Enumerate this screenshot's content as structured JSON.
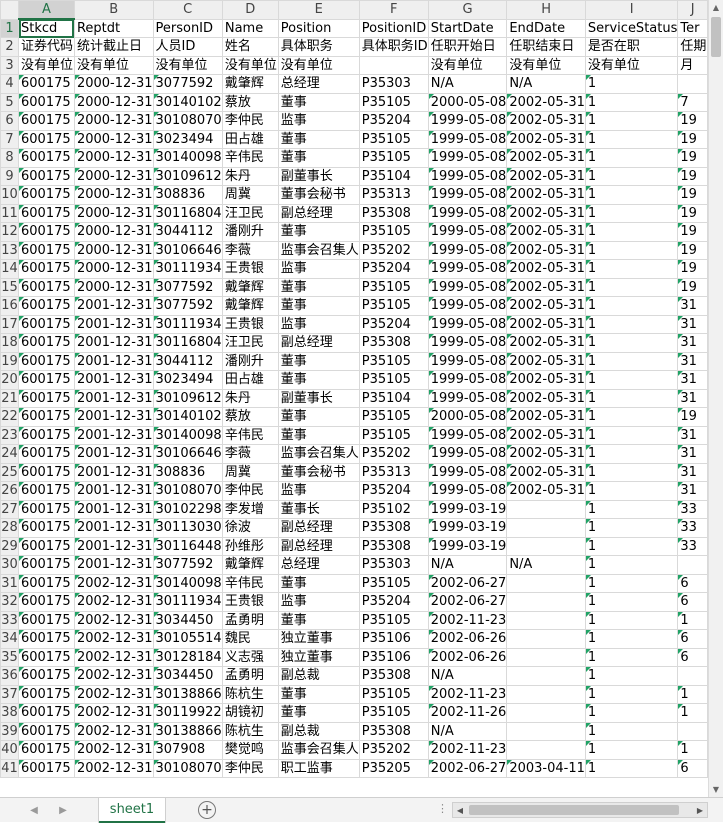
{
  "columns": [
    "A",
    "B",
    "C",
    "D",
    "E",
    "F",
    "G",
    "H",
    "I",
    "J"
  ],
  "active_cell": "A1",
  "sheet_tab": "sheet1",
  "row_numbers": [
    "1",
    "2",
    "3",
    "4",
    "5",
    "6",
    "7",
    "8",
    "9",
    "10",
    "11",
    "12",
    "13",
    "14",
    "15",
    "16",
    "17",
    "18",
    "19",
    "20",
    "21",
    "22",
    "23",
    "24",
    "25",
    "26",
    "27",
    "28",
    "29",
    "30",
    "31",
    "32",
    "33",
    "34",
    "35",
    "36",
    "37",
    "38",
    "39",
    "40",
    "41"
  ],
  "rows": [
    [
      "Stkcd",
      "Reptdt",
      "PersonID",
      "Name",
      "Position",
      "PositionID",
      "StartDate",
      "EndDate",
      "ServiceStatus",
      "Ter"
    ],
    [
      "证券代码",
      "统计截止日",
      "人员ID",
      "姓名",
      "具体职务",
      "具体职务ID",
      "任职开始日",
      "任职结束日",
      "是否在职",
      "任期"
    ],
    [
      "没有单位",
      "没有单位",
      "没有单位",
      "没有单位",
      "没有单位",
      "",
      "没有单位",
      "没有单位",
      "没有单位",
      "月"
    ],
    [
      "600175",
      "2000-12-31",
      "3077592",
      "戴肇辉",
      "总经理",
      "P35303",
      "N/A",
      "N/A",
      "1",
      ""
    ],
    [
      "600175",
      "2000-12-31",
      "30140102",
      "蔡放",
      "董事",
      "P35105",
      "2000-05-08",
      "2002-05-31",
      "1",
      "7"
    ],
    [
      "600175",
      "2000-12-31",
      "30108070",
      "李仲民",
      "监事",
      "P35204",
      "1999-05-08",
      "2002-05-31",
      "1",
      "19"
    ],
    [
      "600175",
      "2000-12-31",
      "3023494",
      "田占雄",
      "董事",
      "P35105",
      "1999-05-08",
      "2002-05-31",
      "1",
      "19"
    ],
    [
      "600175",
      "2000-12-31",
      "30140098",
      "辛伟民",
      "董事",
      "P35105",
      "1999-05-08",
      "2002-05-31",
      "1",
      "19"
    ],
    [
      "600175",
      "2000-12-31",
      "30109612",
      "朱丹",
      "副董事长",
      "P35104",
      "1999-05-08",
      "2002-05-31",
      "1",
      "19"
    ],
    [
      "600175",
      "2000-12-31",
      "308836",
      "周冀",
      "董事会秘书",
      "P35313",
      "1999-05-08",
      "2002-05-31",
      "1",
      "19"
    ],
    [
      "600175",
      "2000-12-31",
      "30116804",
      "汪卫民",
      "副总经理",
      "P35308",
      "1999-05-08",
      "2002-05-31",
      "1",
      "19"
    ],
    [
      "600175",
      "2000-12-31",
      "3044112",
      "潘刚升",
      "董事",
      "P35105",
      "1999-05-08",
      "2002-05-31",
      "1",
      "19"
    ],
    [
      "600175",
      "2000-12-31",
      "30106646",
      "李薇",
      "监事会召集人",
      "P35202",
      "1999-05-08",
      "2002-05-31",
      "1",
      "19"
    ],
    [
      "600175",
      "2000-12-31",
      "30111934",
      "王贵银",
      "监事",
      "P35204",
      "1999-05-08",
      "2002-05-31",
      "1",
      "19"
    ],
    [
      "600175",
      "2000-12-31",
      "3077592",
      "戴肇辉",
      "董事",
      "P35105",
      "1999-05-08",
      "2002-05-31",
      "1",
      "19"
    ],
    [
      "600175",
      "2001-12-31",
      "3077592",
      "戴肇辉",
      "董事",
      "P35105",
      "1999-05-08",
      "2002-05-31",
      "1",
      "31"
    ],
    [
      "600175",
      "2001-12-31",
      "30111934",
      "王贵银",
      "监事",
      "P35204",
      "1999-05-08",
      "2002-05-31",
      "1",
      "31"
    ],
    [
      "600175",
      "2001-12-31",
      "30116804",
      "汪卫民",
      "副总经理",
      "P35308",
      "1999-05-08",
      "2002-05-31",
      "1",
      "31"
    ],
    [
      "600175",
      "2001-12-31",
      "3044112",
      "潘刚升",
      "董事",
      "P35105",
      "1999-05-08",
      "2002-05-31",
      "1",
      "31"
    ],
    [
      "600175",
      "2001-12-31",
      "3023494",
      "田占雄",
      "董事",
      "P35105",
      "1999-05-08",
      "2002-05-31",
      "1",
      "31"
    ],
    [
      "600175",
      "2001-12-31",
      "30109612",
      "朱丹",
      "副董事长",
      "P35104",
      "1999-05-08",
      "2002-05-31",
      "1",
      "31"
    ],
    [
      "600175",
      "2001-12-31",
      "30140102",
      "蔡放",
      "董事",
      "P35105",
      "2000-05-08",
      "2002-05-31",
      "1",
      "19"
    ],
    [
      "600175",
      "2001-12-31",
      "30140098",
      "辛伟民",
      "董事",
      "P35105",
      "1999-05-08",
      "2002-05-31",
      "1",
      "31"
    ],
    [
      "600175",
      "2001-12-31",
      "30106646",
      "李薇",
      "监事会召集人",
      "P35202",
      "1999-05-08",
      "2002-05-31",
      "1",
      "31"
    ],
    [
      "600175",
      "2001-12-31",
      "308836",
      "周冀",
      "董事会秘书",
      "P35313",
      "1999-05-08",
      "2002-05-31",
      "1",
      "31"
    ],
    [
      "600175",
      "2001-12-31",
      "30108070",
      "李仲民",
      "监事",
      "P35204",
      "1999-05-08",
      "2002-05-31",
      "1",
      "31"
    ],
    [
      "600175",
      "2001-12-31",
      "30102298",
      "李发增",
      "董事长",
      "P35102",
      "1999-03-19",
      "",
      "1",
      "33"
    ],
    [
      "600175",
      "2001-12-31",
      "30113030",
      "徐波",
      "副总经理",
      "P35308",
      "1999-03-19",
      "",
      "1",
      "33"
    ],
    [
      "600175",
      "2001-12-31",
      "30116448",
      "孙维彤",
      "副总经理",
      "P35308",
      "1999-03-19",
      "",
      "1",
      "33"
    ],
    [
      "600175",
      "2001-12-31",
      "3077592",
      "戴肇辉",
      "总经理",
      "P35303",
      "N/A",
      "N/A",
      "1",
      ""
    ],
    [
      "600175",
      "2002-12-31",
      "30140098",
      "辛伟民",
      "董事",
      "P35105",
      "2002-06-27",
      "",
      "1",
      "6"
    ],
    [
      "600175",
      "2002-12-31",
      "30111934",
      "王贵银",
      "监事",
      "P35204",
      "2002-06-27",
      "",
      "1",
      "6"
    ],
    [
      "600175",
      "2002-12-31",
      "3034450",
      "孟勇明",
      "董事",
      "P35105",
      "2002-11-23",
      "",
      "1",
      "1"
    ],
    [
      "600175",
      "2002-12-31",
      "30105514",
      "魏民",
      "独立董事",
      "P35106",
      "2002-06-26",
      "",
      "1",
      "6"
    ],
    [
      "600175",
      "2002-12-31",
      "30128184",
      "义志强",
      "独立董事",
      "P35106",
      "2002-06-26",
      "",
      "1",
      "6"
    ],
    [
      "600175",
      "2002-12-31",
      "3034450",
      "孟勇明",
      "副总裁",
      "P35308",
      "N/A",
      "",
      "1",
      ""
    ],
    [
      "600175",
      "2002-12-31",
      "30138866",
      "陈杭生",
      "董事",
      "P35105",
      "2002-11-23",
      "",
      "1",
      "1"
    ],
    [
      "600175",
      "2002-12-31",
      "30119922",
      "胡镜初",
      "董事",
      "P35105",
      "2002-11-26",
      "",
      "1",
      "1"
    ],
    [
      "600175",
      "2002-12-31",
      "30138866",
      "陈杭生",
      "副总裁",
      "P35308",
      "N/A",
      "",
      "1",
      ""
    ],
    [
      "600175",
      "2002-12-31",
      "307908",
      "樊觉鸣",
      "监事会召集人",
      "P35202",
      "2002-11-23",
      "",
      "1",
      "1"
    ],
    [
      "600175",
      "2002-12-31",
      "30108070",
      "李仲民",
      "职工监事",
      "P35205",
      "2002-06-27",
      "2003-04-11",
      "1",
      "6"
    ]
  ]
}
